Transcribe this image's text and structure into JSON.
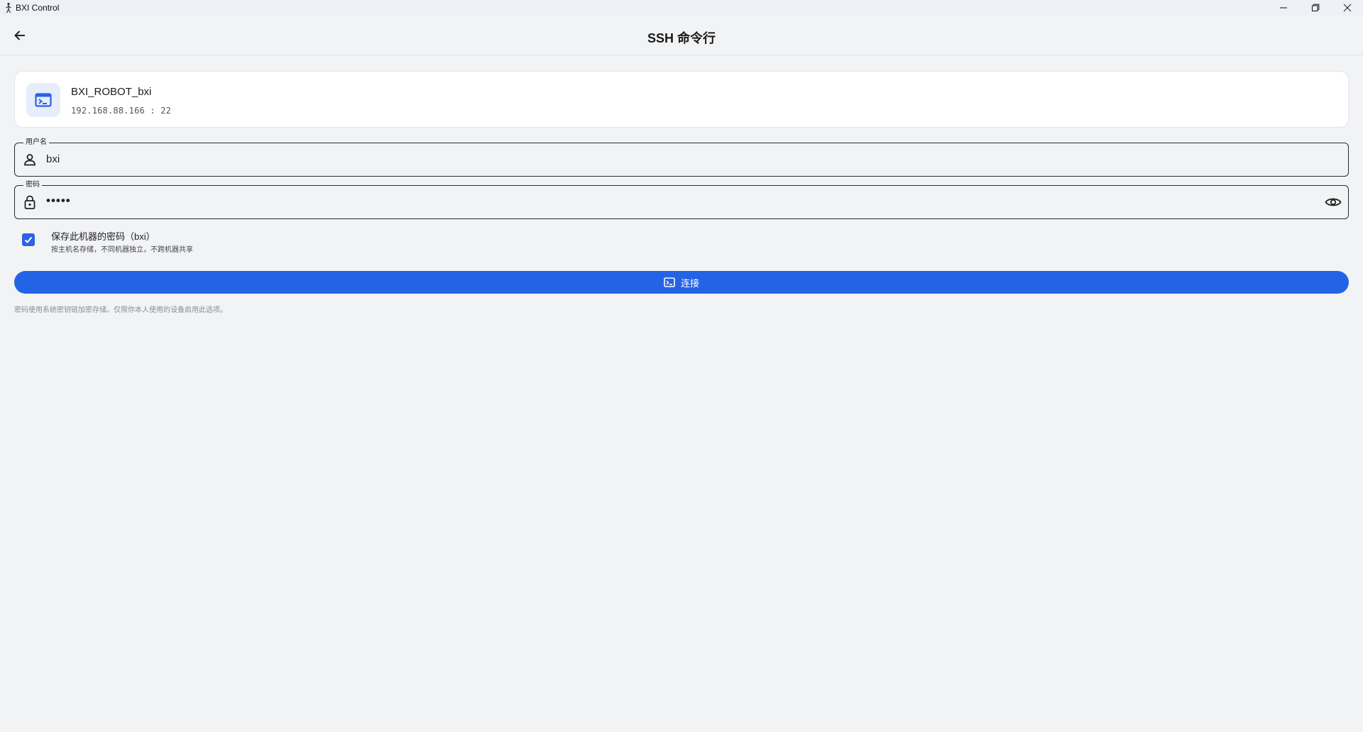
{
  "window": {
    "title": "BXI Control",
    "controls": [
      "minimize",
      "restore",
      "close"
    ]
  },
  "appbar": {
    "back_icon": "arrow-left-icon",
    "title": "SSH 命令行"
  },
  "host": {
    "icon": "terminal-icon",
    "name": "BXI_ROBOT_bxi",
    "address": "192.168.88.166 : 22"
  },
  "username_field": {
    "label": "用户名",
    "icon": "person-icon",
    "value": "bxi"
  },
  "password_field": {
    "label": "密码",
    "icon": "lock-icon",
    "value": "•••••",
    "toggle_icon": "eye-icon"
  },
  "save_password": {
    "checked": true,
    "title": "保存此机器的密码（bxi）",
    "subtitle": "按主机名存储，不同机器独立，不跨机器共享"
  },
  "connect_button": {
    "icon": "terminal-icon",
    "label": "连接"
  },
  "footnote": "密码使用系统密钥链加密存储。仅限你本人使用的设备启用此选项。",
  "colors": {
    "accent": "#2563e6",
    "background": "#f2f3f5",
    "card": "#ffffff"
  }
}
